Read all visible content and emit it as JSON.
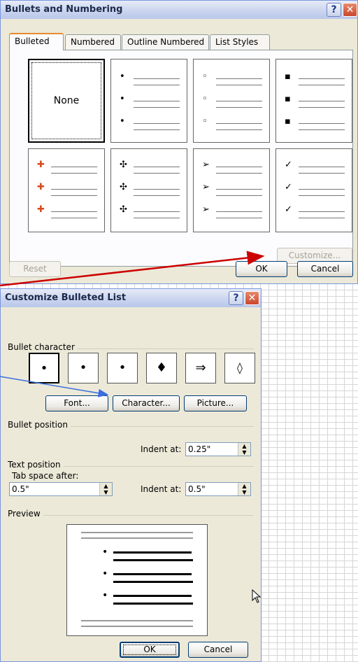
{
  "dialog1": {
    "title": "Bullets and Numbering",
    "tabs": [
      {
        "label": "Bulleted",
        "active": true
      },
      {
        "label": "Numbered",
        "active": false
      },
      {
        "label": "Outline Numbered",
        "active": false
      },
      {
        "label": "List Styles",
        "active": false
      }
    ],
    "none_label": "None",
    "bullet_styles": [
      "•",
      "◦",
      "▪",
      "✚",
      "✣",
      "➢",
      "✓"
    ],
    "buttons": {
      "customize": "Customize...",
      "reset": "Reset",
      "ok": "OK",
      "cancel": "Cancel"
    }
  },
  "dialog2": {
    "title": "Customize Bulleted List",
    "bullet_character_label": "Bullet character",
    "characters": [
      "•",
      "•",
      "•",
      "♦",
      "⇒",
      "◊"
    ],
    "buttons": {
      "font": "Font...",
      "character": "Character...",
      "picture": "Picture...",
      "ok": "OK",
      "cancel": "Cancel"
    },
    "bullet_position_label": "Bullet position",
    "indent_at_label": "Indent at:",
    "bullet_indent_value": "0.25\"",
    "text_position_label": "Text position",
    "tab_space_label": "Tab space after:",
    "tab_space_value": "0.5\"",
    "text_indent_label": "Indent at:",
    "text_indent_value": "0.5\"",
    "preview_label": "Preview"
  },
  "colors": {
    "arrow_red": "#cc0000",
    "arrow_blue": "#3b6fe0"
  }
}
